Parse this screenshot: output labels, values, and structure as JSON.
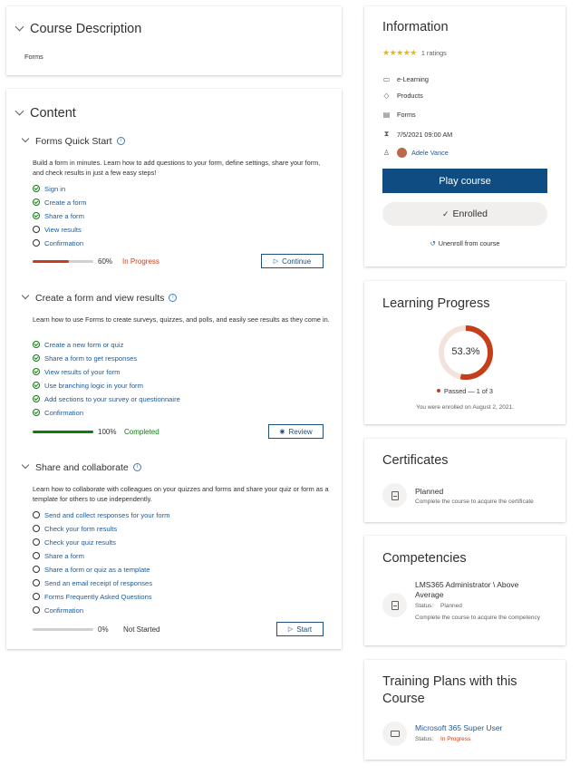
{
  "course_description": {
    "title": "Course Description",
    "text": "Forms"
  },
  "content": {
    "title": "Content",
    "modules": [
      {
        "title": "Forms Quick Start",
        "description": "Build a form in minutes. Learn how to add questions to your form, define settings, share your form, and check results in just a few easy steps!",
        "steps": [
          {
            "label": "Sign in",
            "done": true
          },
          {
            "label": "Create a form",
            "done": true
          },
          {
            "label": "Share a form",
            "done": true
          },
          {
            "label": "View results",
            "done": false
          },
          {
            "label": "Confirmation",
            "done": false
          }
        ],
        "progress": 0.6,
        "progress_text": "60%",
        "status": "In Progress",
        "action": "Continue"
      },
      {
        "title": "Create a form and view results",
        "description": "Learn how to use Forms to create surveys, quizzes, and polls, and easily see results as they come in.",
        "steps": [
          {
            "label": "Create a new form or quiz",
            "done": true
          },
          {
            "label": "Share a form to get responses",
            "done": true
          },
          {
            "label": "View results of your form",
            "done": true
          },
          {
            "label": "Use branching logic in your form",
            "done": true
          },
          {
            "label": "Add sections to your survey or questionnaire",
            "done": true
          },
          {
            "label": "Confirmation",
            "done": true
          }
        ],
        "progress": 1.0,
        "progress_text": "100%",
        "status": "Completed",
        "action": "Review"
      },
      {
        "title": "Share and collaborate",
        "description": "Learn how to collaborate with colleagues on your quizzes and forms and share your quiz or form as a template for others to use independently.",
        "steps": [
          {
            "label": "Send and collect responses for your form",
            "done": false
          },
          {
            "label": "Check your form results",
            "done": false
          },
          {
            "label": "Check your quiz results",
            "done": false
          },
          {
            "label": "Share a form",
            "done": false
          },
          {
            "label": "Share a form or quiz as a template",
            "done": false
          },
          {
            "label": "Send an email receipt of responses",
            "done": false
          },
          {
            "label": "Forms Frequently Asked Questions",
            "done": false
          },
          {
            "label": "Confirmation",
            "done": false
          }
        ],
        "progress": 0.0,
        "progress_text": "0%",
        "status": "Not Started",
        "action": "Start"
      }
    ]
  },
  "information": {
    "title": "Information",
    "stars": "★★★★★",
    "rating_value": 5,
    "ratings_text": "1 ratings",
    "format": "e-Learning",
    "category": "Products",
    "subject": "Forms",
    "date": "7/5/2021 09:00 AM",
    "author": "Adele Vance",
    "play_button": "Play course",
    "enrolled_button": "Enrolled",
    "unenroll_link": "Unenroll from course"
  },
  "learning_progress": {
    "title": "Learning Progress",
    "percent_value": 53.3,
    "percent_text": "53.3%",
    "legend": "Passed — 1 of 3",
    "enrolled_note": "You were enrolled on August 2, 2021."
  },
  "certificates": {
    "title": "Certificates",
    "item_title": "Planned",
    "item_desc": "Complete the course to acquire the certificate"
  },
  "competencies": {
    "title": "Competencies",
    "item_title": "LMS365 Administrator \\ Above Average",
    "status_label": "Status:",
    "status_value": "Planned",
    "item_desc": "Complete the course to acquire the competency"
  },
  "training_plans": {
    "title": "Training Plans with this Course",
    "item_title": "Microsoft 365 Super User",
    "status_label": "Status:",
    "status_value": "In Progress"
  },
  "colors": {
    "accent": "#0f4c81",
    "progress_orange": "#c43e1c",
    "completed_green": "#107c10",
    "link_blue": "#1f5a96",
    "star_gold": "#f2b600"
  }
}
